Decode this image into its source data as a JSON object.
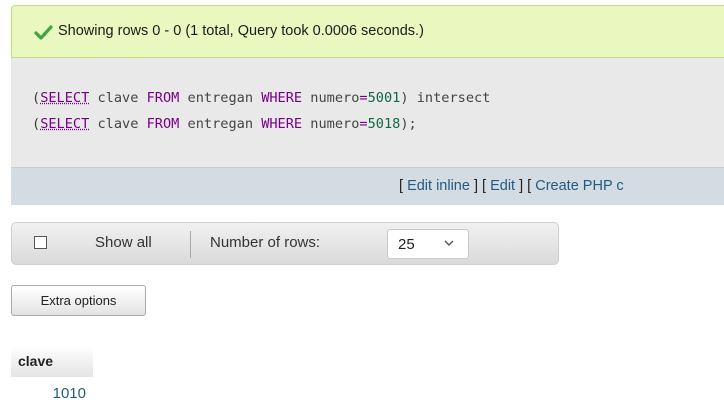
{
  "success": {
    "icon": "checkmark-icon",
    "message": "Showing rows 0 - 0 (1 total, Query took 0.0006 seconds.)"
  },
  "sql": {
    "line1": [
      "(",
      "SELECT",
      " clave ",
      "FROM",
      " entregan ",
      "WHERE",
      " numero",
      "=",
      "5001",
      ") intersect"
    ],
    "line2": [
      "(",
      "SELECT",
      " clave ",
      "FROM",
      " entregan ",
      "WHERE",
      " numero",
      "=",
      "5018",
      ");"
    ]
  },
  "actions": {
    "open1": "[ ",
    "edit_inline": "Edit inline",
    "mid1": " ] [ ",
    "edit": "Edit",
    "mid2": " ] [ ",
    "create_php": "Create PHP c"
  },
  "navigation": {
    "show_all": "Show all",
    "number_of_rows_label": "Number of rows:",
    "rows_selected": "25"
  },
  "extra_options": "Extra options",
  "table": {
    "columns": [
      "clave"
    ],
    "rows": [
      [
        "1010"
      ]
    ]
  },
  "colors": {
    "success_bg": "#eaf7bf",
    "link": "#235a81",
    "keyword": "#770088",
    "number": "#116644"
  }
}
